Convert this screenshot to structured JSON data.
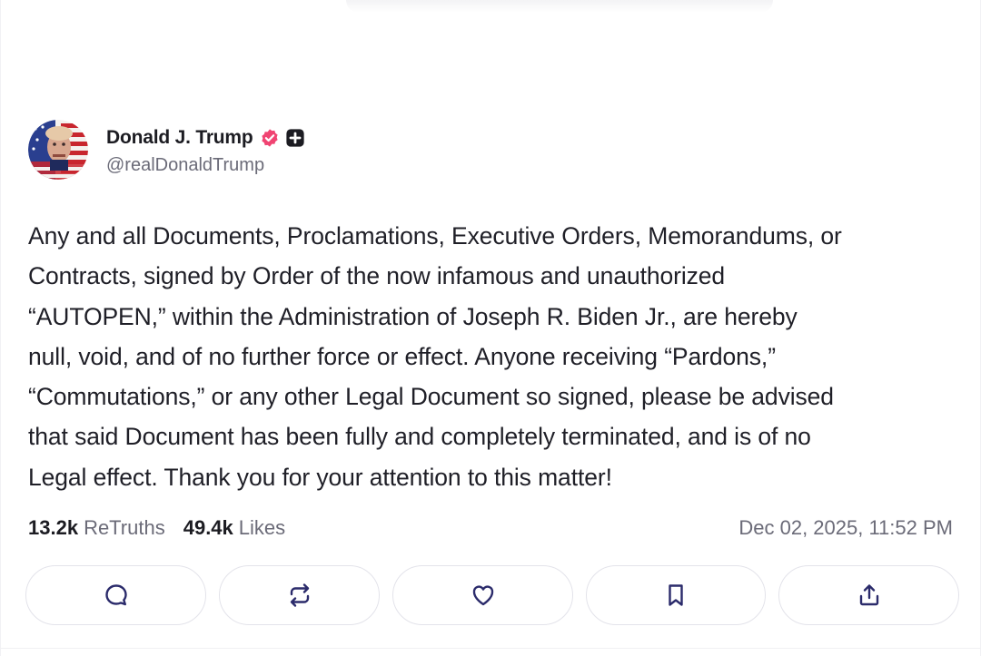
{
  "author": {
    "display_name": "Donald J. Trump",
    "handle": "@realDonaldTrump"
  },
  "post": {
    "text": "Any and all Documents, Proclamations, Executive Orders, Memorandums, or\nContracts, signed by Order of the now infamous and unauthorized\n“AUTOPEN,” within the Administration of Joseph R. Biden Jr., are hereby\nnull, void, and of no further force or effect. Anyone receiving “Pardons,”\n“Commutations,” or any other Legal Document so signed, please be advised\nthat said Document has been fully and completely terminated, and is of no\nLegal effect. Thank you for your attention to this matter!"
  },
  "stats": {
    "retruths_count": "13.2k",
    "retruths_label": "ReTruths",
    "likes_count": "49.4k",
    "likes_label": "Likes",
    "timestamp": "Dec 02, 2025, 11:52 PM"
  },
  "actions": [
    {
      "icon": "reply-icon"
    },
    {
      "icon": "retruth-icon"
    },
    {
      "icon": "heart-icon"
    },
    {
      "icon": "bookmark-icon"
    },
    {
      "icon": "share-icon"
    }
  ],
  "colors": {
    "verified_badge": "#f04472",
    "text_primary": "#1f1f27",
    "text_secondary": "#6b6b78",
    "button_border": "#e3e3ea",
    "icon_color": "#2b2b6b"
  }
}
